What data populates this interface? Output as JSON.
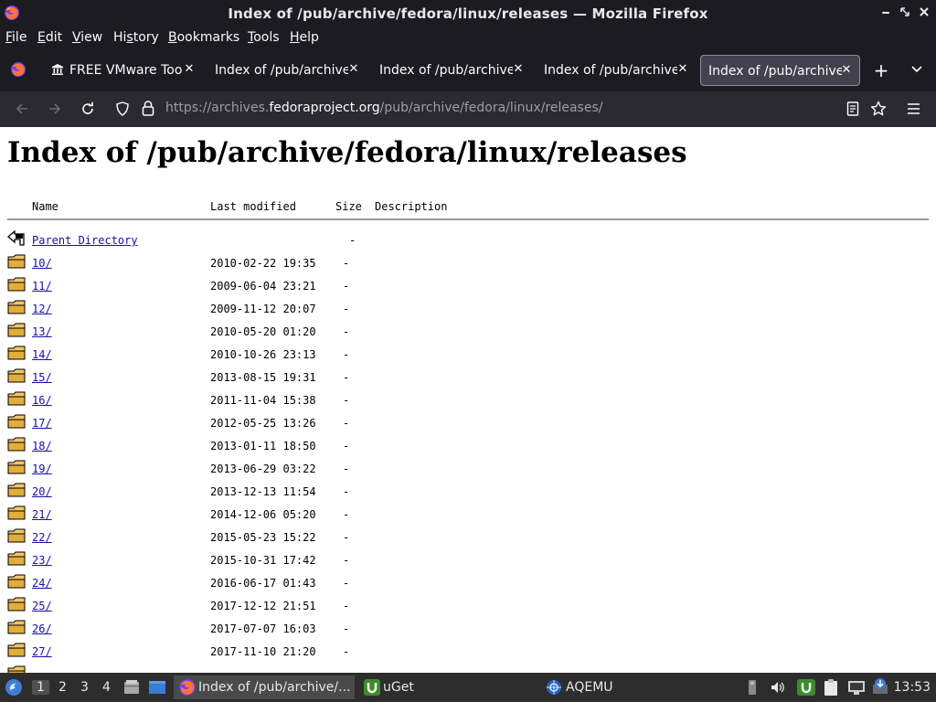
{
  "window": {
    "title": "Index of /pub/archive/fedora/linux/releases — Mozilla Firefox"
  },
  "menubar": {
    "items": [
      {
        "mnemonic": "F",
        "rest": "ile"
      },
      {
        "mnemonic": "E",
        "rest": "dit"
      },
      {
        "mnemonic": "V",
        "rest": "iew"
      },
      {
        "pre": "Hi",
        "mnemonic": "s",
        "rest": "tory"
      },
      {
        "mnemonic": "B",
        "rest": "ookmarks"
      },
      {
        "mnemonic": "T",
        "rest": "ools"
      },
      {
        "mnemonic": "H",
        "rest": "elp"
      }
    ]
  },
  "tabs": [
    {
      "label": "FREE VMware Tools"
    },
    {
      "label": "Index of /pub/archive/"
    },
    {
      "label": "Index of /pub/archive/"
    },
    {
      "label": "Index of /pub/archive/"
    },
    {
      "label": "Index of /pub/archive/"
    }
  ],
  "urlbar": {
    "prefix": "https://archives.",
    "domain": "fedoraproject.org",
    "path": "/pub/archive/fedora/linux/releases/"
  },
  "page": {
    "heading": "Index of /pub/archive/fedora/linux/releases",
    "columns": {
      "name": "Name",
      "modified": "Last modified",
      "size": "Size",
      "description": "Description"
    },
    "parent": {
      "name": "Parent Directory",
      "size": "-"
    },
    "rows": [
      {
        "name": "10/",
        "modified": "2010-02-22 19:35",
        "size": "-"
      },
      {
        "name": "11/",
        "modified": "2009-06-04 23:21",
        "size": "-"
      },
      {
        "name": "12/",
        "modified": "2009-11-12 20:07",
        "size": "-"
      },
      {
        "name": "13/",
        "modified": "2010-05-20 01:20",
        "size": "-"
      },
      {
        "name": "14/",
        "modified": "2010-10-26 23:13",
        "size": "-"
      },
      {
        "name": "15/",
        "modified": "2013-08-15 19:31",
        "size": "-"
      },
      {
        "name": "16/",
        "modified": "2011-11-04 15:38",
        "size": "-"
      },
      {
        "name": "17/",
        "modified": "2012-05-25 13:26",
        "size": "-"
      },
      {
        "name": "18/",
        "modified": "2013-01-11 18:50",
        "size": "-"
      },
      {
        "name": "19/",
        "modified": "2013-06-29 03:22",
        "size": "-"
      },
      {
        "name": "20/",
        "modified": "2013-12-13 11:54",
        "size": "-"
      },
      {
        "name": "21/",
        "modified": "2014-12-06 05:20",
        "size": "-"
      },
      {
        "name": "22/",
        "modified": "2015-05-23 15:22",
        "size": "-"
      },
      {
        "name": "23/",
        "modified": "2015-10-31 17:42",
        "size": "-"
      },
      {
        "name": "24/",
        "modified": "2016-06-17 01:43",
        "size": "-"
      },
      {
        "name": "25/",
        "modified": "2017-12-12 21:51",
        "size": "-"
      },
      {
        "name": "26/",
        "modified": "2017-07-07 16:03",
        "size": "-"
      },
      {
        "name": "27/",
        "modified": "2017-11-10 21:20",
        "size": "-"
      }
    ]
  },
  "taskbar": {
    "workspaces": [
      "1",
      "2",
      "3",
      "4"
    ],
    "tasks": [
      {
        "label": "Index of /pub/archive/..."
      },
      {
        "label": "uGet"
      },
      {
        "label": "AQEMU"
      }
    ],
    "clock": "13:53"
  }
}
